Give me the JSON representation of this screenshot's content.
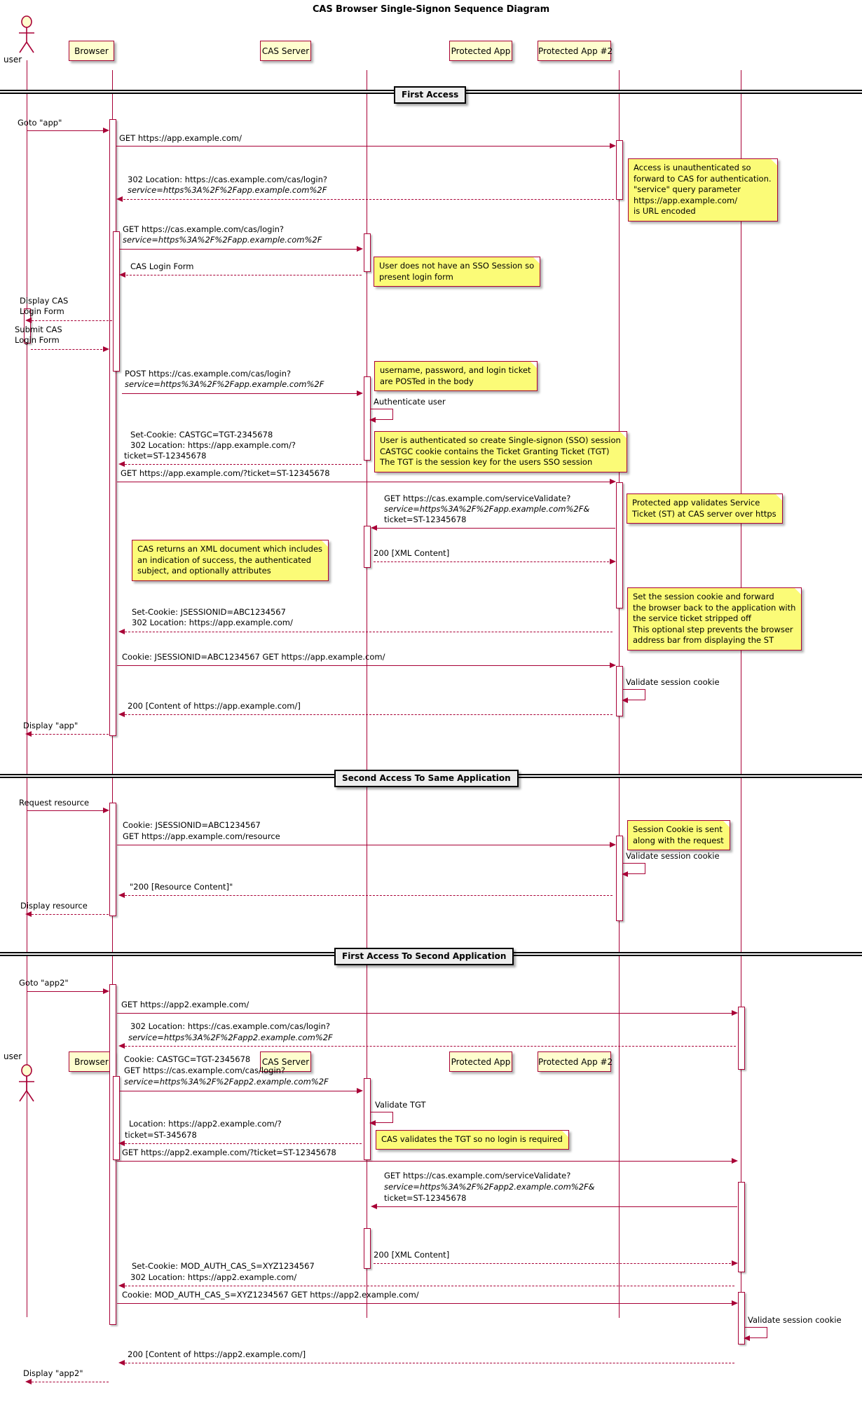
{
  "title": "CAS Browser Single-Signon Sequence Diagram",
  "participants": [
    {
      "id": "user",
      "label": "user",
      "type": "actor"
    },
    {
      "id": "browser",
      "label": "Browser",
      "type": "box"
    },
    {
      "id": "cas",
      "label": "CAS Server",
      "type": "box"
    },
    {
      "id": "app",
      "label": "Protected App",
      "type": "box"
    },
    {
      "id": "app2",
      "label": "Protected App #2",
      "type": "box"
    }
  ],
  "dividers": [
    {
      "label": "First Access"
    },
    {
      "label": "Second Access To Same Application"
    },
    {
      "label": "First Access To Second Application"
    }
  ],
  "messages": [
    {
      "id": "m01",
      "text_lines": [
        "Goto \"app\""
      ]
    },
    {
      "id": "m02",
      "text_lines": [
        "GET https://app.example.com/"
      ]
    },
    {
      "id": "m03",
      "text_lines": [
        "302 Location: https://cas.example.com/cas/login?",
        "service=https%3A%2F%2Fapp.example.com%2F"
      ]
    },
    {
      "id": "m04",
      "text_lines": [
        "GET https://cas.example.com/cas/login?",
        "service=https%3A%2F%2Fapp.example.com%2F"
      ]
    },
    {
      "id": "m05",
      "text_lines": [
        "CAS Login Form"
      ]
    },
    {
      "id": "m06",
      "text_lines": [
        "Display CAS",
        "Login Form"
      ]
    },
    {
      "id": "m07",
      "text_lines": [
        "Submit CAS",
        "Login Form"
      ]
    },
    {
      "id": "m08",
      "text_lines": [
        "POST https://cas.example.com/cas/login?",
        "service=https%3A%2F%2Fapp.example.com%2F"
      ]
    },
    {
      "id": "m09",
      "text_lines": [
        "Authenticate user"
      ]
    },
    {
      "id": "m10",
      "text_lines": [
        "Set-Cookie: CASTGC=TGT-2345678",
        "302 Location: https://app.example.com/?",
        "ticket=ST-12345678"
      ]
    },
    {
      "id": "m11",
      "text_lines": [
        "GET https://app.example.com/?ticket=ST-12345678"
      ]
    },
    {
      "id": "m12",
      "text_lines": [
        "GET https://cas.example.com/serviceValidate?",
        "service=https%3A%2F%2Fapp.example.com%2F&",
        "ticket=ST-12345678"
      ]
    },
    {
      "id": "m13",
      "text_lines": [
        "200 [XML Content]"
      ]
    },
    {
      "id": "m14",
      "text_lines": [
        "Set-Cookie: JSESSIONID=ABC1234567",
        "302 Location: https://app.example.com/"
      ]
    },
    {
      "id": "m15",
      "text_lines": [
        "Cookie: JSESSIONID=ABC1234567 GET https://app.example.com/"
      ]
    },
    {
      "id": "m16",
      "text_lines": [
        "Validate session cookie"
      ]
    },
    {
      "id": "m17",
      "text_lines": [
        "200 [Content of https://app.example.com/]"
      ]
    },
    {
      "id": "m18",
      "text_lines": [
        "Display \"app\""
      ]
    },
    {
      "id": "m19",
      "text_lines": [
        "Request resource"
      ]
    },
    {
      "id": "m20",
      "text_lines": [
        "Cookie: JSESSIONID=ABC1234567",
        "GET https://app.example.com/resource"
      ]
    },
    {
      "id": "m21",
      "text_lines": [
        "Validate session cookie"
      ]
    },
    {
      "id": "m22",
      "text_lines": [
        "\"200 [Resource Content]\""
      ]
    },
    {
      "id": "m23",
      "text_lines": [
        "Display resource"
      ]
    },
    {
      "id": "m24",
      "text_lines": [
        "Goto \"app2\""
      ]
    },
    {
      "id": "m25",
      "text_lines": [
        "GET https://app2.example.com/"
      ]
    },
    {
      "id": "m26",
      "text_lines": [
        "302 Location: https://cas.example.com/cas/login?",
        "service=https%3A%2F%2Fapp2.example.com%2F"
      ]
    },
    {
      "id": "m27",
      "text_lines": [
        "Cookie: CASTGC=TGT-2345678",
        "GET https://cas.example.com/cas/login?",
        "service=https%3A%2F%2Fapp2.example.com%2F"
      ]
    },
    {
      "id": "m28",
      "text_lines": [
        "Validate TGT"
      ]
    },
    {
      "id": "m29",
      "text_lines": [
        "Location: https://app2.example.com/?",
        "ticket=ST-345678"
      ]
    },
    {
      "id": "m30",
      "text_lines": [
        "GET https://app2.example.com/?ticket=ST-12345678"
      ]
    },
    {
      "id": "m31",
      "text_lines": [
        "GET https://cas.example.com/serviceValidate?",
        "service=https%3A%2F%2Fapp2.example.com%2F&",
        "ticket=ST-12345678"
      ]
    },
    {
      "id": "m32",
      "text_lines": [
        "200 [XML Content]"
      ]
    },
    {
      "id": "m33",
      "text_lines": [
        "Set-Cookie: MOD_AUTH_CAS_S=XYZ1234567",
        "302 Location: https://app2.example.com/"
      ]
    },
    {
      "id": "m34",
      "text_lines": [
        "Cookie: MOD_AUTH_CAS_S=XYZ1234567 GET https://app2.example.com/"
      ]
    },
    {
      "id": "m35",
      "text_lines": [
        "Validate session cookie"
      ]
    },
    {
      "id": "m36",
      "text_lines": [
        "200 [Content of https://app2.example.com/]"
      ]
    },
    {
      "id": "m37",
      "text_lines": [
        "Display \"app2\""
      ]
    }
  ],
  "notes": [
    {
      "id": "n1",
      "lines": [
        "Access is unauthenticated so",
        "forward to CAS for authentication.",
        "\"service\" query parameter",
        "https://app.example.com/",
        "is URL encoded"
      ]
    },
    {
      "id": "n2",
      "lines": [
        "User does not have an SSO Session so",
        "present login form"
      ]
    },
    {
      "id": "n3",
      "lines": [
        "username, password, and login ticket",
        "are POSTed in the body"
      ]
    },
    {
      "id": "n4",
      "lines": [
        "User is authenticated so create Single-signon (SSO) session",
        "CASTGC cookie contains the Ticket Granting Ticket (TGT)",
        "The TGT is the session key for the users SSO session"
      ]
    },
    {
      "id": "n5",
      "lines": [
        "Protected app validates Service",
        "Ticket (ST) at CAS server over https"
      ]
    },
    {
      "id": "n6",
      "lines": [
        "CAS returns an XML document which includes",
        "an indication of success, the authenticated",
        "subject, and optionally attributes"
      ]
    },
    {
      "id": "n7",
      "lines": [
        "Set the session cookie and forward",
        "the browser back to the application with",
        "the service ticket stripped off",
        "This optional step prevents the browser",
        "address bar from displaying the ST"
      ]
    },
    {
      "id": "n8",
      "lines": [
        "Session Cookie is sent",
        "along with the request"
      ]
    },
    {
      "id": "n9",
      "lines": [
        "CAS validates the TGT so no login is required"
      ]
    }
  ],
  "colors": {
    "line": "#A80036",
    "participant_fill": "#FEFECE",
    "note_fill": "#FBFB77",
    "divider_fill": "#EEEEEE"
  }
}
